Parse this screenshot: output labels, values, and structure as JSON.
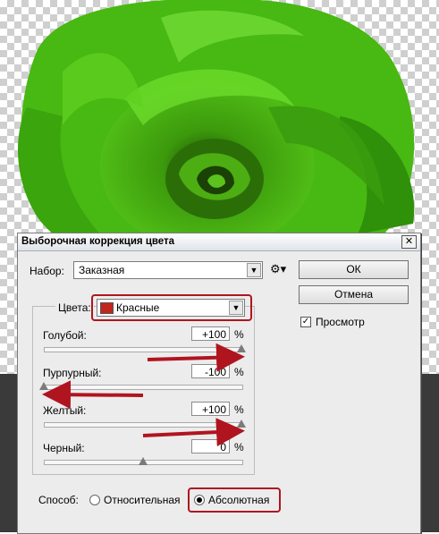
{
  "dialog": {
    "title": "Выборочная коррекция цвета",
    "close_glyph": "✕",
    "preset_label": "Набор:",
    "preset_value": "Заказная",
    "ok_label": "ОК",
    "cancel_label": "Отмена",
    "preview_label": "Просмотр",
    "preview_checked": true,
    "colors_label": "Цвета:",
    "colors_value": "Красные",
    "colors_swatch": "#c0261d",
    "sliders": [
      {
        "label": "Голубой:",
        "value": "+100",
        "unit": "%",
        "percent": 100
      },
      {
        "label": "Пурпурный:",
        "value": "-100",
        "unit": "%",
        "percent": -100
      },
      {
        "label": "Желтый:",
        "value": "+100",
        "unit": "%",
        "percent": 100
      },
      {
        "label": "Черный:",
        "value": "0",
        "unit": "%",
        "percent": 0
      }
    ],
    "method_label": "Способ:",
    "method_relative": "Относительная",
    "method_absolute": "Абсолютная",
    "method_selected": "absolute"
  },
  "colors": {
    "annotation": "#b0151f",
    "rose": "#3fb110"
  }
}
